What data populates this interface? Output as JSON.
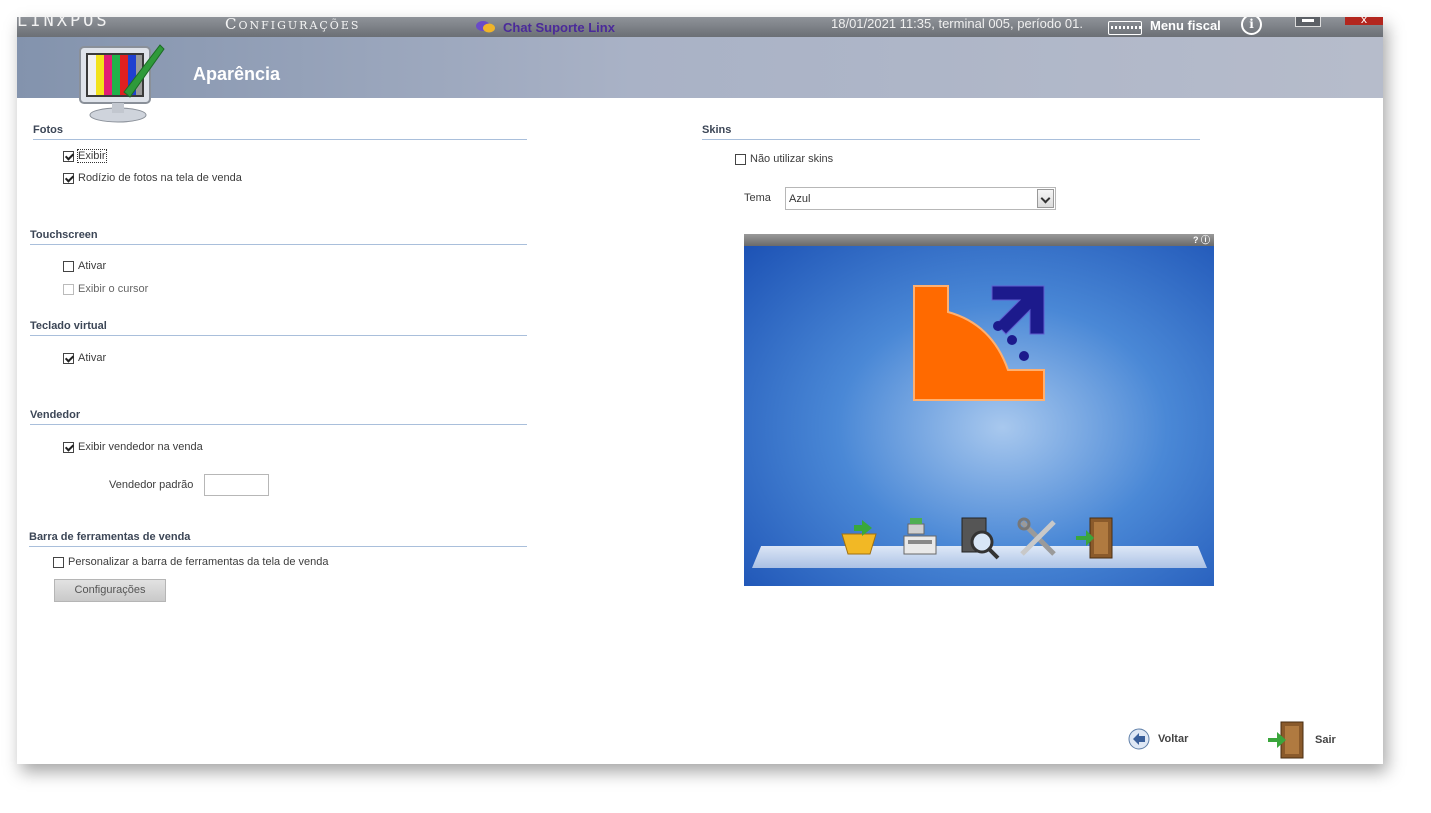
{
  "topbar": {
    "app_name": "LINXPOS",
    "module": "Configurações",
    "chat_label": "Chat Suporte Linx",
    "status": "18/01/2021 11:35, terminal 005, período 01.",
    "menu_fiscal": "Menu fiscal",
    "info_label": "i",
    "close_label": "x"
  },
  "header": {
    "title": "Aparência"
  },
  "fotos": {
    "title": "Fotos",
    "exibir": "Exibir",
    "rodizio": "Rodízio de fotos na tela de venda"
  },
  "touchscreen": {
    "title": "Touchscreen",
    "ativar": "Ativar",
    "exibir_cursor": "Exibir o cursor"
  },
  "teclado": {
    "title": "Teclado virtual",
    "ativar": "Ativar"
  },
  "vendedor": {
    "title": "Vendedor",
    "exibir": "Exibir vendedor na venda",
    "padrao_label": "Vendedor padrão",
    "padrao_value": ""
  },
  "barra": {
    "title": "Barra de ferramentas de venda",
    "personalizar": "Personalizar a barra de ferramentas da tela de venda",
    "config_button": "Configurações"
  },
  "skins": {
    "title": "Skins",
    "nao_utilizar": "Não utilizar skins",
    "tema_label": "Tema",
    "tema_value": "Azul",
    "preview_bar": "? ⓘ"
  },
  "footer": {
    "voltar": "Voltar",
    "sair": "Sair"
  },
  "colors": {
    "header_band": "#8393ad",
    "section_line": "#a9bfdb",
    "chat_text": "#4b2a9a",
    "preview_blue": "#1a4fb3",
    "logo_orange": "#ff6a00",
    "logo_navy": "#1c1a8c"
  }
}
